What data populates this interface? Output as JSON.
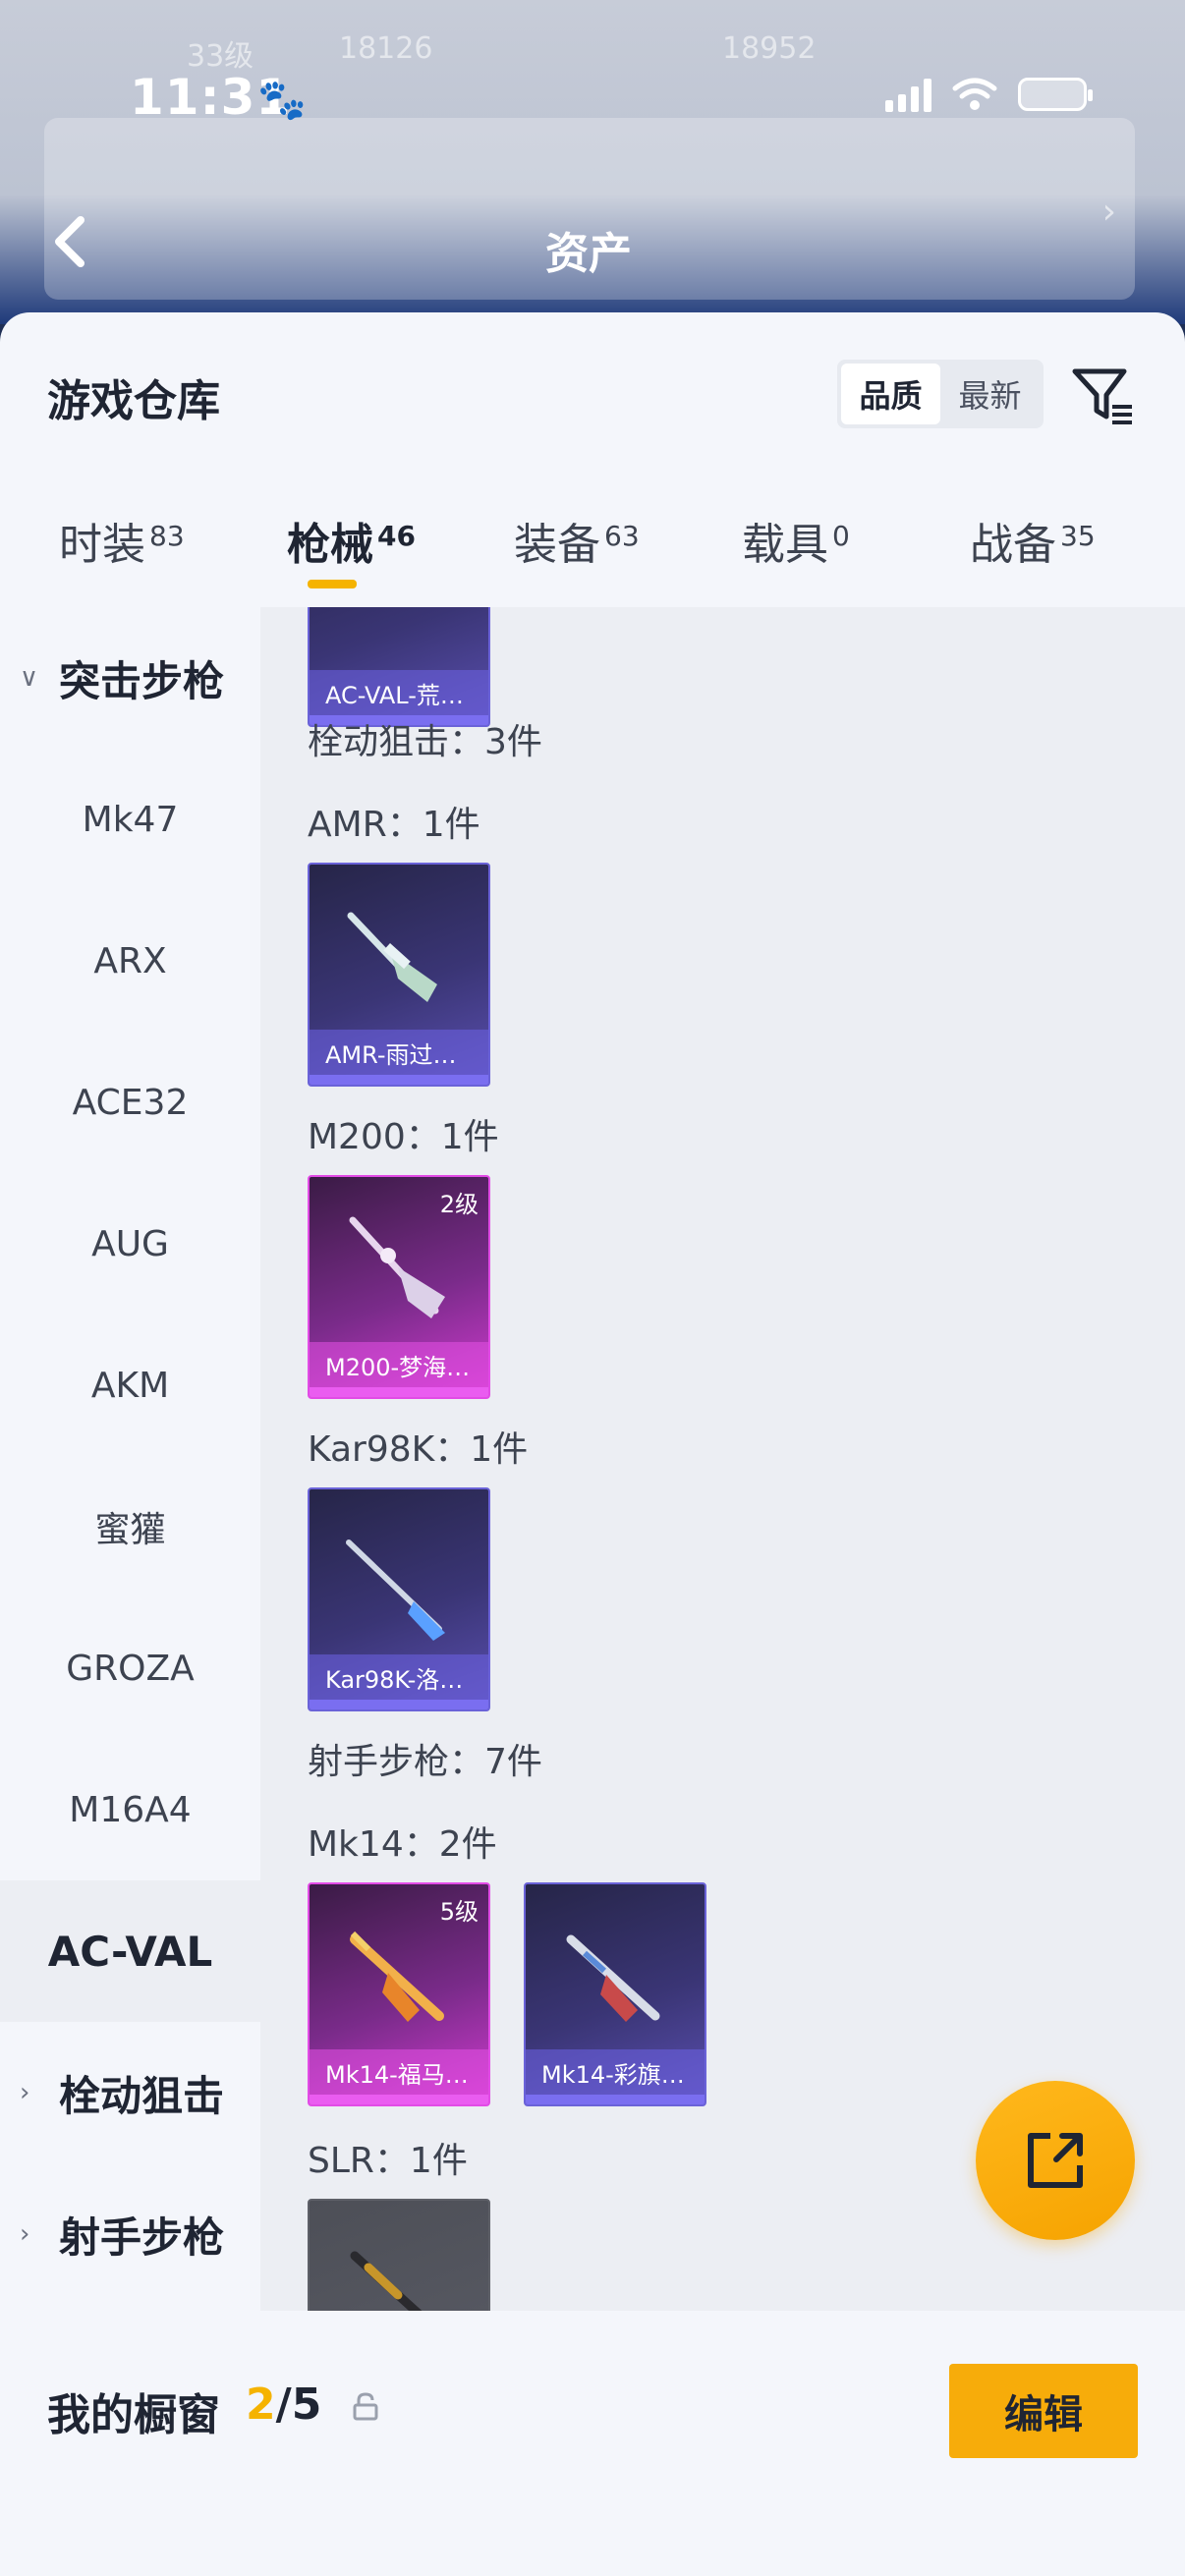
{
  "status_bar": {
    "time": "11:31"
  },
  "header_bg": {
    "title": "资产",
    "level": "33级",
    "stat_a": "18126",
    "stat_b": "18952"
  },
  "sheet": {
    "title": "游戏仓库",
    "sort": {
      "quality": "品质",
      "latest": "最新"
    }
  },
  "tabs": [
    {
      "label": "时装",
      "count": "83"
    },
    {
      "label": "枪械",
      "count": "46"
    },
    {
      "label": "装备",
      "count": "63"
    },
    {
      "label": "载具",
      "count": "0"
    },
    {
      "label": "战备",
      "count": "35"
    }
  ],
  "sidebar": {
    "groups": {
      "assault": "突击步枪",
      "bolt": "栓动狙击",
      "marksman": "射手步枪"
    },
    "items": [
      "Mk47",
      "ARX",
      "ACE32",
      "AUG",
      "AKM",
      "蜜獾",
      "GROZA",
      "M16A4",
      "AC-VAL"
    ]
  },
  "content": {
    "top_card": {
      "name": "AC-VAL-荒…"
    },
    "bolt_header": "栓动狙击：3件",
    "amr_header": "AMR：1件",
    "amr_card": {
      "name": "AMR-雨过…"
    },
    "m200_header": "M200：1件",
    "m200_card": {
      "name": "M200-梦海…",
      "level": "2级"
    },
    "kar_header": "Kar98K：1件",
    "kar_card": {
      "name": "Kar98K-洛…"
    },
    "marksman_header": "射手步枪：7件",
    "mk14_header": "Mk14：2件",
    "mk14_card1": {
      "name": "Mk14-福马…",
      "level": "5级"
    },
    "mk14_card2": {
      "name": "Mk14-彩旗…"
    },
    "slr_header": "SLR：1件"
  },
  "bottom": {
    "label": "我的橱窗",
    "current": "2",
    "total": "/5",
    "edit": "编辑"
  },
  "colors": {
    "accent": "#f5b300",
    "fab": "#f6a300",
    "rare_purple": "#6a62d8",
    "epic_pink": "#e24be6"
  }
}
